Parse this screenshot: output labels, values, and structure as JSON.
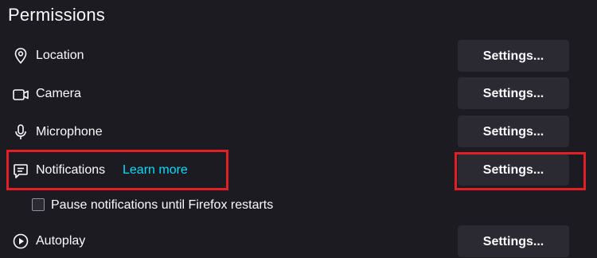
{
  "section": {
    "title": "Permissions"
  },
  "rows": [
    {
      "label": "Location",
      "icon": "location-pin-icon",
      "button": "Settings..."
    },
    {
      "label": "Camera",
      "icon": "camera-icon",
      "button": "Settings..."
    },
    {
      "label": "Microphone",
      "icon": "microphone-icon",
      "button": "Settings..."
    },
    {
      "label": "Notifications",
      "icon": "notification-icon",
      "button": "Settings...",
      "link": "Learn more"
    },
    {
      "label": "Autoplay",
      "icon": "autoplay-icon",
      "button": "Settings..."
    }
  ],
  "pause_notifications": {
    "label": "Pause notifications until Firefox restarts",
    "checked": false
  },
  "colors": {
    "background": "#1c1b22",
    "button": "#2b2a33",
    "link": "#00ddff",
    "highlight": "#e31f26"
  }
}
